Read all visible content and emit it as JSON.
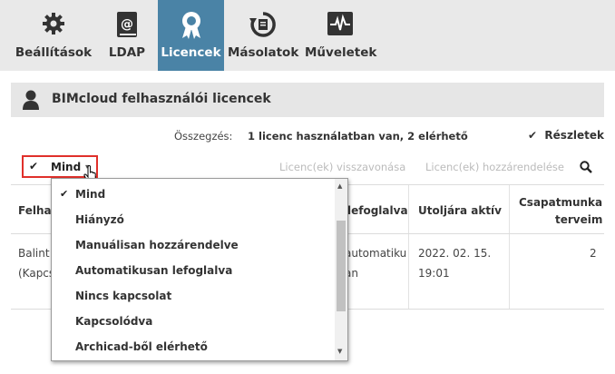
{
  "toolbar": {
    "tabs": [
      {
        "label": "Beállítások",
        "icon": "gear-icon"
      },
      {
        "label": "LDAP",
        "icon": "ldap-book-icon"
      },
      {
        "label": "Licencek",
        "icon": "ribbon-badge-icon",
        "active": true
      },
      {
        "label": "Másolatok",
        "icon": "backup-clock-icon"
      },
      {
        "label": "Műveletek",
        "icon": "activity-monitor-icon"
      }
    ]
  },
  "section": {
    "title": "BIMcloud felhasználói licencek",
    "icon": "user-icon"
  },
  "summary": {
    "label": "Összegzés:",
    "value": "1 licenc használatban van, 2 elérhető",
    "details": "Részletek"
  },
  "filter": {
    "check": "✔",
    "label": "Mind",
    "arrow": "▾"
  },
  "actions": {
    "revoke": "Licenc(ek) visszavonása",
    "assign": "Licenc(ek) hozzárendelése"
  },
  "table": {
    "headers": {
      "user": "Felhas",
      "reserved": "lefoglalva",
      "last_active": "Utoljára aktív",
      "team_line1": "Csapatmunka",
      "team_line2": "terveim"
    },
    "row": {
      "user_line1": "Balint",
      "user_line2": "(Kapcs",
      "reserved_line1": "automatiku",
      "reserved_line2": "an",
      "last_active_line1": "2022. 02. 15.",
      "last_active_line2": "19:01",
      "team": "2"
    }
  },
  "dropdown": {
    "items": [
      {
        "label": "Mind",
        "checked": true
      },
      {
        "label": "Hiányzó"
      },
      {
        "label": "Manuálisan hozzárendelve"
      },
      {
        "label": "Automatikusan lefoglalva"
      },
      {
        "label": "Nincs kapcsolat"
      },
      {
        "label": "Kapcsolódva"
      },
      {
        "label": "Archicad-ből elérhető"
      }
    ]
  },
  "colors": {
    "accent": "#4a83a6",
    "highlight": "#e0302b",
    "toolbar_bg": "#e9e9e9"
  }
}
